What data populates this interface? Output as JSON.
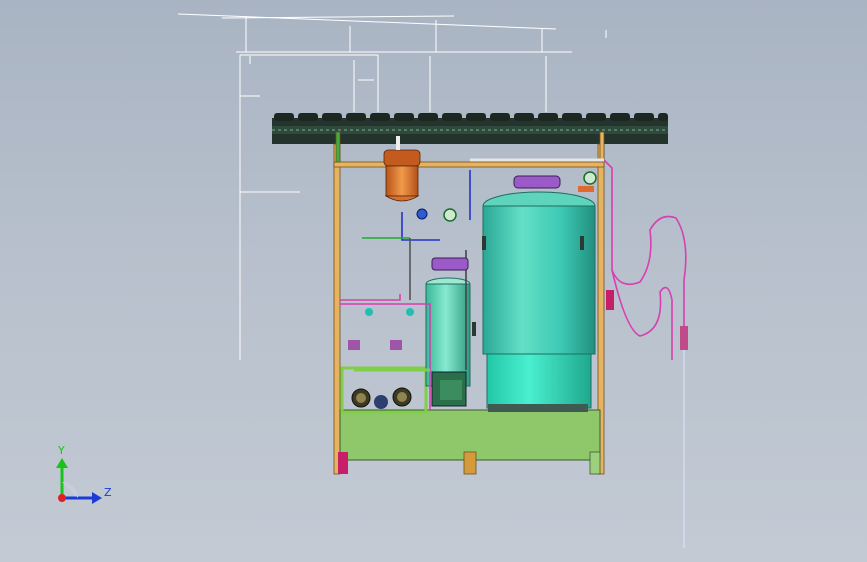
{
  "viewport": {
    "background_top": "#a9b4c3",
    "background_bottom": "#c3cad4"
  },
  "triad": {
    "y_label": "Y",
    "z_label": "Z",
    "y_color": "#19c419",
    "z_color": "#1a3bd6",
    "x_color": "#e02020"
  },
  "model": {
    "frame_color": "#e6b460",
    "base_color": "#8fc86a",
    "tank_large_color": "#3cc9b4",
    "tank_small_color": "#5fd4b0",
    "vessel_color": "#e07a2e",
    "roof_color": "#2b3a33",
    "pipe_pink": "#d83fb0",
    "pipe_blue": "#2233cc",
    "pipe_green": "#22aa33"
  }
}
